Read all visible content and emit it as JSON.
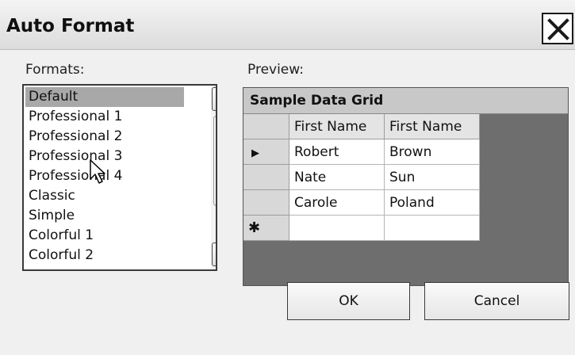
{
  "dialog": {
    "title": "Auto Format"
  },
  "formats": {
    "label": "Formats:",
    "items": [
      "Default",
      "Professional 1",
      "Professional 2",
      "Professional 3",
      "Professional 4",
      "Classic",
      "Simple",
      "Colorful 1",
      "Colorful 2"
    ],
    "selected": "Default"
  },
  "preview": {
    "label": "Preview:",
    "caption": "Sample Data Grid",
    "columns": [
      "First Name",
      "First Name"
    ],
    "rows": [
      {
        "marker": "▶",
        "cells": [
          "Robert",
          "Brown"
        ]
      },
      {
        "marker": "",
        "cells": [
          "Nate",
          "Sun"
        ]
      },
      {
        "marker": "",
        "cells": [
          "Carole",
          "Poland"
        ]
      },
      {
        "marker": "✱",
        "cells": [
          "",
          ""
        ]
      }
    ]
  },
  "buttons": {
    "ok": "OK",
    "cancel": "Cancel"
  }
}
